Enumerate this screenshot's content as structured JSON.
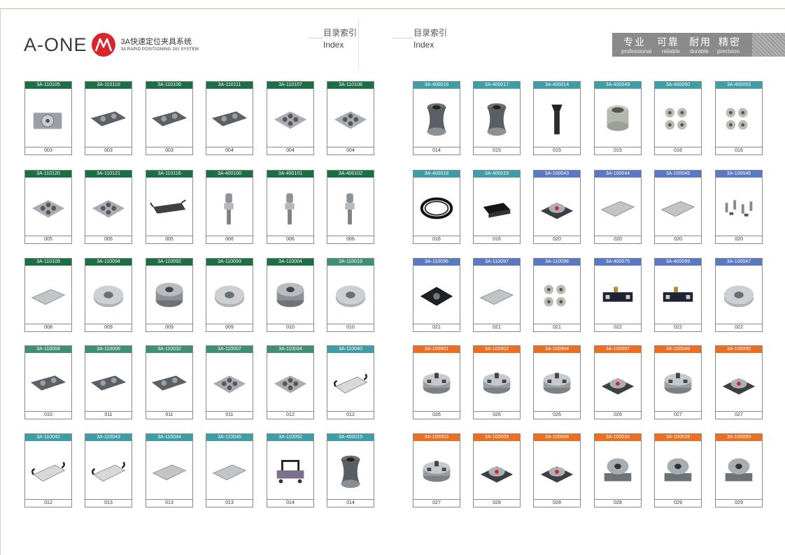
{
  "header": {
    "brand": "A-ONE",
    "tagline_cn": "3A快速定位夹具系统",
    "tagline_en": "3A RAPID POSITIONING JIG SYSTEM",
    "index_left_cn": "目录索引",
    "index_left_en": "Index",
    "index_right_cn": "目录索引",
    "index_right_en": "Index",
    "slogan": [
      {
        "cn": "专业",
        "en": "professional"
      },
      {
        "cn": "可靠",
        "en": "reliable"
      },
      {
        "cn": "耐用",
        "en": "durable"
      },
      {
        "cn": "精密",
        "en": "precision"
      }
    ]
  },
  "colors": {
    "green": "#1c6e45",
    "teal_green": "#3e8f74",
    "teal": "#3e9ea6",
    "blue": "#5b78c2",
    "orange": "#ee6e1f",
    "brand_red": "#d8262c"
  },
  "left_page": [
    [
      {
        "code": "3A-110105",
        "page": "003",
        "color": "green",
        "icon": "plate-chuck-icon"
      },
      {
        "code": "3A-110110",
        "page": "003",
        "color": "green",
        "icon": "long-plate-icon"
      },
      {
        "code": "3A-110106",
        "page": "003",
        "color": "green",
        "icon": "long-plate-icon"
      },
      {
        "code": "3A-110111",
        "page": "004",
        "color": "green",
        "icon": "long-plate-icon"
      },
      {
        "code": "3A-110107",
        "page": "004",
        "color": "green",
        "icon": "square-plate-icon"
      },
      {
        "code": "3A-110108",
        "page": "004",
        "color": "green",
        "icon": "square-plate-icon"
      }
    ],
    [
      {
        "code": "3A-110120",
        "page": "005",
        "color": "green",
        "icon": "square-plate-icon"
      },
      {
        "code": "3A-110121",
        "page": "005",
        "color": "green",
        "icon": "square-plate-icon"
      },
      {
        "code": "3A-110116",
        "page": "005",
        "color": "green",
        "icon": "tray-icon"
      },
      {
        "code": "3A-400100",
        "page": "006",
        "color": "green",
        "icon": "pin-icon"
      },
      {
        "code": "3A-400101",
        "page": "006",
        "color": "green",
        "icon": "pin-icon"
      },
      {
        "code": "3A-400102",
        "page": "006",
        "color": "green",
        "icon": "pin-icon"
      }
    ],
    [
      {
        "code": "3A-110109",
        "page": "008",
        "color": "green",
        "icon": "flat-plate-icon"
      },
      {
        "code": "3A-110094",
        "page": "009",
        "color": "green",
        "icon": "round-disc-icon"
      },
      {
        "code": "3A-110092",
        "page": "009",
        "color": "green",
        "icon": "round-chuck-icon"
      },
      {
        "code": "3A-110093",
        "page": "009",
        "color": "green",
        "icon": "round-disc-icon"
      },
      {
        "code": "3A-110004",
        "page": "010",
        "color": "green",
        "icon": "round-chuck-icon"
      },
      {
        "code": "3A-110019",
        "page": "010",
        "color": "teal_green",
        "icon": "round-disc-icon"
      }
    ],
    [
      {
        "code": "3A-110008",
        "page": "010",
        "color": "teal_green",
        "icon": "long-plate-icon"
      },
      {
        "code": "3A-110006",
        "page": "011",
        "color": "teal_green",
        "icon": "long-plate-icon"
      },
      {
        "code": "3A-110032",
        "page": "011",
        "color": "teal_green",
        "icon": "long-plate-icon"
      },
      {
        "code": "3A-110007",
        "page": "011",
        "color": "teal_green",
        "icon": "square-plate-icon"
      },
      {
        "code": "3A-110034",
        "page": "012",
        "color": "teal_green",
        "icon": "square-plate-icon"
      },
      {
        "code": "3A-110040",
        "page": "012",
        "color": "teal",
        "icon": "handle-plate-icon"
      }
    ],
    [
      {
        "code": "3A-110042",
        "page": "012",
        "color": "teal",
        "icon": "handle-plate-icon"
      },
      {
        "code": "3A-110043",
        "page": "013",
        "color": "teal",
        "icon": "handle-plate-icon"
      },
      {
        "code": "3A-110044",
        "page": "013",
        "color": "teal",
        "icon": "flat-plate-icon"
      },
      {
        "code": "3A-110045",
        "page": "013",
        "color": "teal",
        "icon": "flat-plate-icon"
      },
      {
        "code": "3A-110052",
        "page": "014",
        "color": "teal",
        "icon": "cart-icon"
      },
      {
        "code": "3A-400015",
        "page": "014",
        "color": "teal",
        "icon": "spool-icon"
      }
    ]
  ],
  "right_page": [
    [
      {
        "code": "3A-400016",
        "page": "014",
        "color": "teal",
        "icon": "spool-icon"
      },
      {
        "code": "3A-400017",
        "page": "015",
        "color": "teal",
        "icon": "spool-icon"
      },
      {
        "code": "3A-400014",
        "page": "015",
        "color": "teal",
        "icon": "bolt-icon"
      },
      {
        "code": "3A-400049",
        "page": "015",
        "color": "teal",
        "icon": "ring-icon"
      },
      {
        "code": "3A-400050",
        "page": "016",
        "color": "teal",
        "icon": "ring-group-icon"
      },
      {
        "code": "3A-400053",
        "page": "016",
        "color": "teal",
        "icon": "ring-group-icon"
      }
    ],
    [
      {
        "code": "3A-400018",
        "page": "016",
        "color": "teal",
        "icon": "o-ring-icon"
      },
      {
        "code": "3A-400019",
        "page": "016",
        "color": "teal",
        "icon": "block-icon"
      },
      {
        "code": "3A-100043",
        "page": "020",
        "color": "blue",
        "icon": "chuck-base-icon"
      },
      {
        "code": "3A-100044",
        "page": "020",
        "color": "blue",
        "icon": "flat-plate-icon"
      },
      {
        "code": "3A-100045",
        "page": "020",
        "color": "blue",
        "icon": "flat-plate-icon"
      },
      {
        "code": "3A-100046",
        "page": "020",
        "color": "blue",
        "icon": "pin-set-icon"
      }
    ],
    [
      {
        "code": "3A-110096",
        "page": "021",
        "color": "blue",
        "icon": "dark-plate-icon"
      },
      {
        "code": "3A-110097",
        "page": "021",
        "color": "blue",
        "icon": "flat-plate-icon"
      },
      {
        "code": "3A-110098",
        "page": "021",
        "color": "blue",
        "icon": "ring-group-icon"
      },
      {
        "code": "3A-400075",
        "page": "022",
        "color": "blue",
        "icon": "vise-icon"
      },
      {
        "code": "3A-400099",
        "page": "022",
        "color": "blue",
        "icon": "vise-icon"
      },
      {
        "code": "3A-100047",
        "page": "022",
        "color": "blue",
        "icon": "round-disc-icon"
      }
    ],
    [
      {
        "code": "3A-100901",
        "page": "026",
        "color": "orange",
        "icon": "three-jaw-chuck-icon"
      },
      {
        "code": "3A-100902",
        "page": "026",
        "color": "orange",
        "icon": "three-jaw-chuck-icon"
      },
      {
        "code": "3A-100904",
        "page": "026",
        "color": "orange",
        "icon": "three-jaw-chuck-icon"
      },
      {
        "code": "3A-100057",
        "page": "026",
        "color": "orange",
        "icon": "chuck-base-icon"
      },
      {
        "code": "3A-100049",
        "page": "027",
        "color": "orange",
        "icon": "three-jaw-chuck-icon"
      },
      {
        "code": "3A-100050",
        "page": "027",
        "color": "orange",
        "icon": "chuck-base-icon"
      }
    ],
    [
      {
        "code": "3A-100003",
        "page": "027",
        "color": "orange",
        "icon": "three-jaw-chuck-icon"
      },
      {
        "code": "3A-100009",
        "page": "028",
        "color": "orange",
        "icon": "chuck-base-icon"
      },
      {
        "code": "3A-100004",
        "page": "028",
        "color": "orange",
        "icon": "chuck-base-icon"
      },
      {
        "code": "3A-100034",
        "page": "028",
        "color": "orange",
        "icon": "rotary-table-icon"
      },
      {
        "code": "3A-100028",
        "page": "029",
        "color": "orange",
        "icon": "rotary-table-icon"
      },
      {
        "code": "3A-100069",
        "page": "029",
        "color": "orange",
        "icon": "rotary-table-icon"
      }
    ]
  ]
}
